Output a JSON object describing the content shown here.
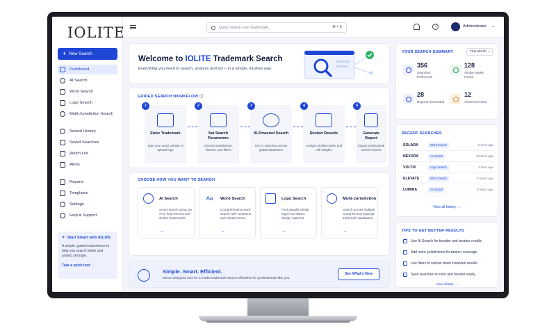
{
  "brand": {
    "logo_text": "IOLITE"
  },
  "sidebar": {
    "new_search_label": "New Search",
    "items": [
      {
        "label": "Dashboard"
      },
      {
        "label": "AI Search"
      },
      {
        "label": "Word Search"
      },
      {
        "label": "Logo Search"
      },
      {
        "label": "Multi-Jurisdiction Search"
      },
      {
        "label": "Search History"
      },
      {
        "label": "Saved Searches"
      },
      {
        "label": "Watch List"
      },
      {
        "label": "Alerts"
      },
      {
        "label": "Reports"
      },
      {
        "label": "Templates"
      },
      {
        "label": "Settings"
      },
      {
        "label": "Help & Support"
      }
    ],
    "promo": {
      "title": "Start Smart with IOLITE",
      "body": "A simple, guided experience to help you search better and protect stronger.",
      "link": "Take a quick tour →"
    }
  },
  "topbar": {
    "search_placeholder": "Quick search your trademark...",
    "shortcut": "⌘ + K",
    "user_name": "Administrator"
  },
  "welcome": {
    "title_prefix": "Welcome to ",
    "title_highlight": "IOLITE",
    "title_suffix": " Trademark Search",
    "subtitle": "Everything you need to search, analyze and act – in a simple, intuitive way."
  },
  "workflow": {
    "title": "GUIDED SEARCH WORKFLOW",
    "steps": [
      {
        "num": "1",
        "title": "Enter Trademark",
        "desc": "Type your word, phrase or upload logo"
      },
      {
        "num": "2",
        "title": "Set Search Parameters",
        "desc": "Choose jurisdictions, classes, and filters"
      },
      {
        "num": "3",
        "title": "AI-Powered Search",
        "desc": "Our AI searches across global databases"
      },
      {
        "num": "4",
        "title": "Review Results",
        "desc": "Analyze similar marks and risk insights"
      },
      {
        "num": "5",
        "title": "Generate Report",
        "desc": "Export professional search reports"
      }
    ]
  },
  "choose": {
    "title": "CHOOSE HOW YOU WANT TO SEARCH",
    "modes": [
      {
        "title": "AI Search",
        "desc": "Smart search using our AI to find relevant and similar trademarks.",
        "glyph": ""
      },
      {
        "title": "Word Search",
        "desc": "Comprehensive word search with variations and related terms.",
        "glyph": "Aa"
      },
      {
        "title": "Logo Search",
        "desc": "Find visually similar logos and detect design matches.",
        "glyph": ""
      },
      {
        "title": "Multi-Jurisdiction",
        "desc": "Search across multiple countries and regional trademark databases.",
        "glyph": ""
      }
    ],
    "arrow": "→"
  },
  "banner": {
    "title": "Simple. Smart. Efficient.",
    "desc": "We've designed IOLITE to make trademark search effortless for professionals like you.",
    "button": "See What's New"
  },
  "summary": {
    "title": "YOUR SEARCH SUMMARY",
    "period": "This Month ⌄",
    "stats": [
      {
        "value": "356",
        "label": "Searches Performed"
      },
      {
        "value": "128",
        "label": "Similar Marks Found"
      },
      {
        "value": "28",
        "label": "Reports Generated"
      },
      {
        "value": "12",
        "label": "Alerts Received"
      }
    ]
  },
  "recent": {
    "title": "RECENT SEARCHES",
    "rows": [
      {
        "name": "SOLARA",
        "type": "Word Search",
        "time": "2 mins ago"
      },
      {
        "name": "NEXORA",
        "type": "AI Search",
        "time": "15 mins ago"
      },
      {
        "name": "VOLTIX",
        "type": "Logo Search",
        "time": "1 hour ago"
      },
      {
        "name": "ELEVATE",
        "type": "Word Search",
        "time": "3 hours ago"
      },
      {
        "name": "LUMINA",
        "type": "AI Search",
        "time": "5 hours ago"
      }
    ],
    "view_all": "View all history →"
  },
  "tips": {
    "title": "TIPS TO GET BETTER RESULTS",
    "items": [
      {
        "label": "Use AI Search for broader and smarter results"
      },
      {
        "label": "Add more jurisdictions for deeper coverage"
      },
      {
        "label": "Use filters to narrow down irrelevant results"
      },
      {
        "label": "Save searches to track and monitor easily"
      }
    ],
    "view_all": "View all tips →"
  },
  "colors": {
    "accent": "#1f47d6",
    "brand_red": "#b0263f"
  }
}
